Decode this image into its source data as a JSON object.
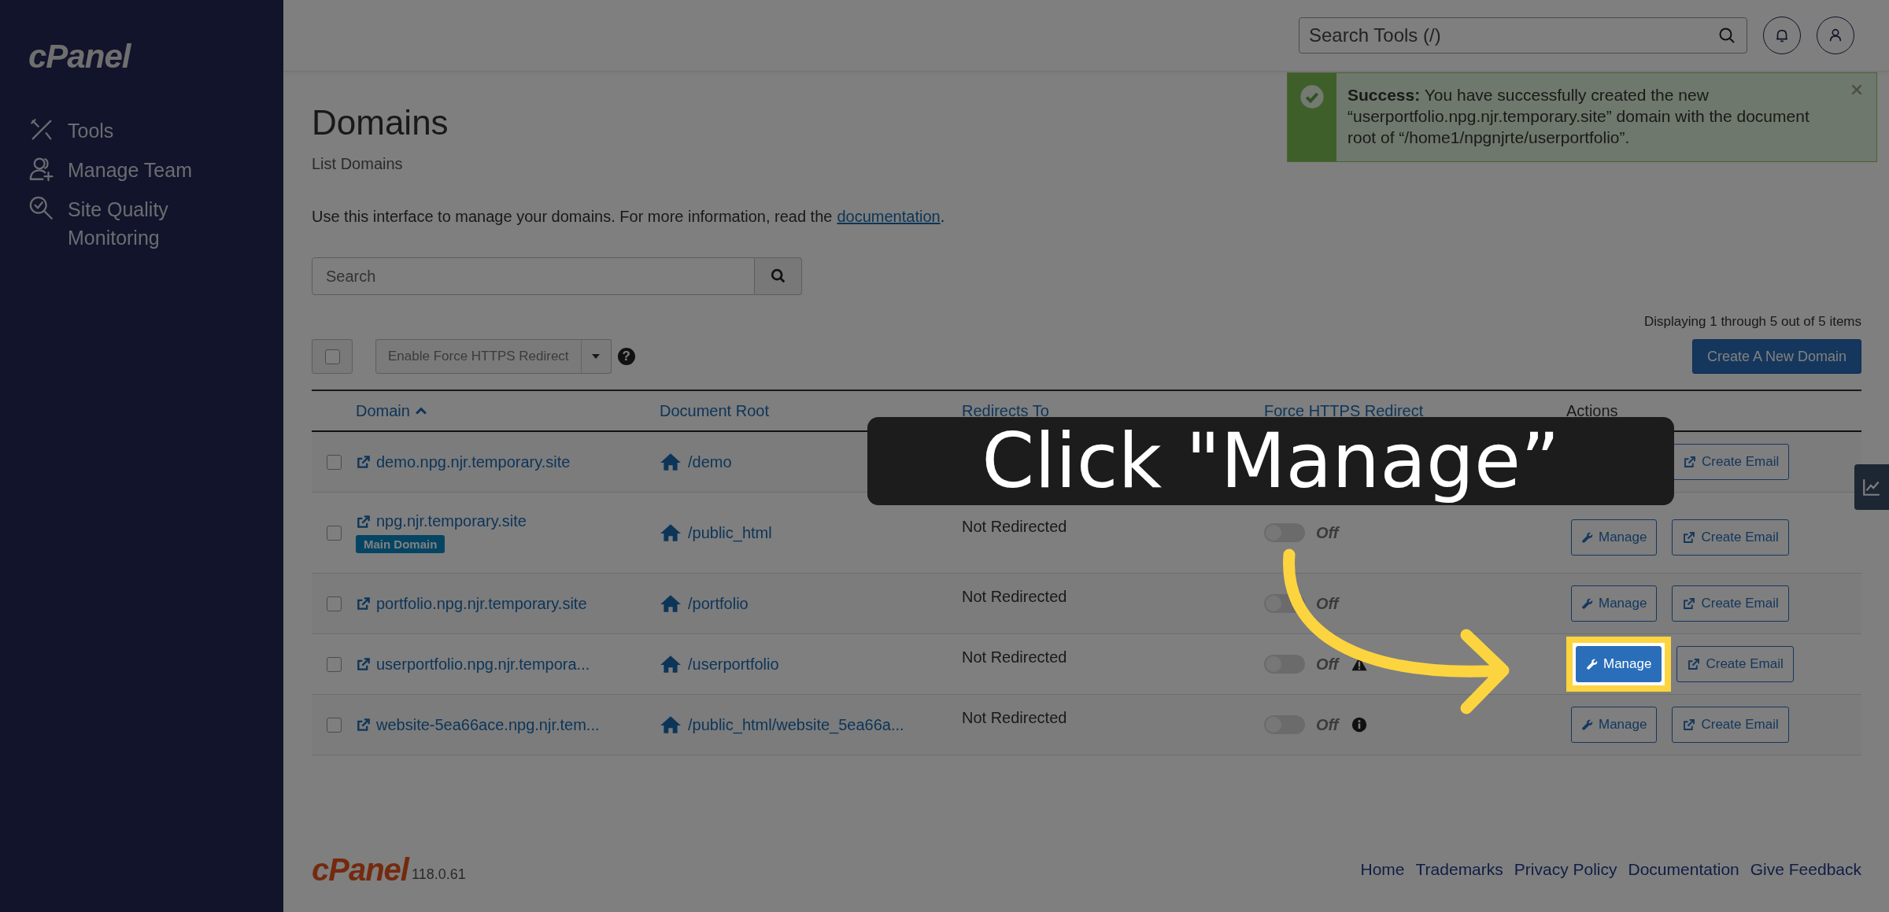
{
  "sidebar": {
    "logo": "cPanel",
    "items": [
      {
        "label": "Tools",
        "kind": "tools"
      },
      {
        "label": "Manage Team",
        "kind": "team"
      },
      {
        "label": "Site Quality Monitoring",
        "kind": "quality"
      }
    ]
  },
  "topbar": {
    "search": {
      "placeholder": "Search Tools (/)"
    }
  },
  "alert": {
    "kind": "success",
    "text": "**Success:** You have successfully created the new “userportfolio.npg.njr.temporary.site” domain with the document root of “/home1/npgnjrte/userportfolio”."
  },
  "page": {
    "title": "Domains",
    "subtitle": "List Domains",
    "intro": "Use this interface to manage your domains. For more information, read the",
    "intro_link": "documentation",
    "intro_end": "."
  },
  "search": {
    "placeholder": "Search"
  },
  "summary": "Displaying 1 through 5 out of 5 items",
  "toolbar": {
    "select_all": {
      "checked": false
    },
    "bulk_action": "Enable Force HTTPS Redirect",
    "help": "?",
    "create_button": "Create A New Domain"
  },
  "table": {
    "columns": [
      {
        "label": "Domain",
        "sorted": true
      },
      {
        "label": "Document Root",
        "sorted": false
      },
      {
        "label": "Redirects To",
        "sorted": false
      },
      {
        "label": "Force HTTPS Redirect",
        "sorted": false
      },
      {
        "label": "Actions",
        "sorted": false
      }
    ],
    "rows": [
      {
        "checked": false,
        "domain": "demo.npg.njr.temporary.site",
        "root": "/demo",
        "email": "Create Email"
      },
      {
        "checked": false,
        "domain": "npg.njr.temporary.site",
        "badge": "Main Domain",
        "root": "/public_html",
        "redirect": "Not Redirected",
        "https": {
          "on": false,
          "label": "Off"
        },
        "manage": "Manage",
        "email": "Create Email",
        "highlighted": false
      },
      {
        "checked": false,
        "domain": "portfolio.npg.njr.temporary.site",
        "root": "/portfolio",
        "redirect": "Not Redirected",
        "https": {
          "on": false,
          "label": "Off"
        },
        "manage": "Manage",
        "email": "Create Email",
        "highlighted": false
      },
      {
        "checked": false,
        "domain": "userportfolio.npg.njr.tempora...",
        "root": "/userportfolio",
        "redirect": "Not Redirected",
        "https": {
          "on": false,
          "label": "Off",
          "note": {
            "kind": "warning"
          }
        },
        "manage": "Manage",
        "email": "Create Email",
        "highlighted": true
      },
      {
        "checked": false,
        "domain": "website-5ea66ace.npg.njr.tem...",
        "root": "/public_html/website_5ea66a...",
        "redirect": "Not Redirected",
        "https": {
          "on": false,
          "label": "Off",
          "note": {
            "kind": "info"
          }
        },
        "manage": "Manage",
        "email": "Create Email",
        "highlighted": false
      }
    ]
  },
  "footer": {
    "logo": "cPanel",
    "version": "118.0.61",
    "links": [
      "Home",
      "Trademarks",
      "Privacy Policy",
      "Documentation",
      "Give Feedback"
    ]
  },
  "tour": {
    "callout": "Click \"Manage”"
  }
}
